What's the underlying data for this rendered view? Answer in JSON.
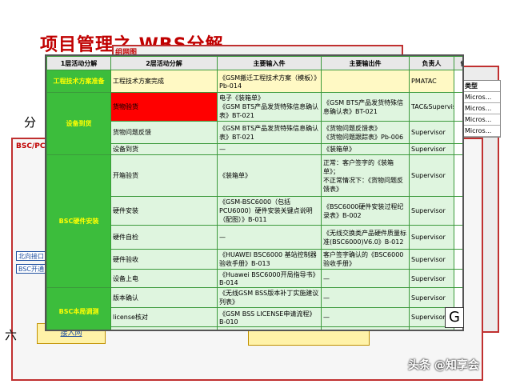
{
  "slide": {
    "title": "项目管理之 WBS分解",
    "left_char_1": "分",
    "left_char_2": "六",
    "side_label_bsc": "BSC/PCU",
    "side_items": [
      "北向接口",
      "BSC开通"
    ],
    "bottom_yellow_1": "接入网",
    "back_red_title": "组网图"
  },
  "back_window_columns": [
    "类型"
  ],
  "back_window_rows": [
    "Micros...",
    "Micros...",
    "Micros...",
    "Micros..."
  ],
  "table": {
    "headers": [
      "1层活动分解",
      "2层活动分解",
      "主要输入件",
      "主要输出件",
      "负责人",
      "备"
    ],
    "rows": [
      {
        "phase": "工程技术方案准备",
        "phase_span": 1,
        "task": "工程技术方案完成",
        "input": "《GSM搬迁工程技术方案（模板）》Pb-014",
        "output": "",
        "owner": "PMATAC",
        "style": "yel"
      },
      {
        "phase": "设备到货",
        "phase_span": 3,
        "task": "货物验货",
        "input": "电子《装箱单》\n《GSM BTS产品发货特殊信息确认表》BT-021",
        "output": "《GSM BTS产品发货特殊信息确认表》BT-021",
        "owner": "TAC&Supervisor",
        "style": "red"
      },
      {
        "task": "货物问题反馈",
        "input": "《GSM BTS产品发货特殊信息确认表》BT-021",
        "output": "《货物问题反馈表》\n《货物问题跟踪表》Pb-006",
        "owner": "Supervisor",
        "style": "grn"
      },
      {
        "task": "设备到货",
        "input": "—",
        "output": "《装箱单》",
        "owner": "Supervisor",
        "style": "grn"
      },
      {
        "phase": "BSC硬件安装",
        "phase_span": 5,
        "task": "开箱验货",
        "input": "《装箱单》",
        "output": "正常：客户签字的《装箱单》；\n不正常情况下：《货物问题反馈表》",
        "owner": "Supervisor",
        "style": "grn"
      },
      {
        "task": "硬件安装",
        "input": "《GSM-BSC6000（包括PCU6000）硬件安装关键点说明（配图）》B-011",
        "output": "《BSC6000硬件安装过程纪录表》B-002",
        "owner": "Supervisor",
        "style": "grn"
      },
      {
        "task": "硬件自检",
        "input": "—",
        "output": "《无线交换类产品硬件质量标准(BSC6000)V6.0》B-012",
        "owner": "Supervisor",
        "style": "grn"
      },
      {
        "task": "硬件验收",
        "input": "《HUAWEI BSC6000 基站控制器验收手册》B-013",
        "output": "客户签字确认的《BSC6000验收手册》",
        "owner": "Supervisor",
        "style": "grn"
      },
      {
        "task": "设备上电",
        "input": "《Huawei BSC6000开局指导书》B-014",
        "output": "—",
        "owner": "Supervisor",
        "style": "grn"
      },
      {
        "phase": "BSC本局调测",
        "phase_span": 3,
        "task": "版本确认",
        "input": "《无线GSM BSS版本补丁实施建议列表》",
        "output": "—",
        "owner": "Supervisor",
        "style": "grn"
      },
      {
        "task": "license核对",
        "input": "《GSM BSS LICENSE申请流程》B-010",
        "output": "—",
        "owner": "Supervisor",
        "style": "grn"
      },
      {
        "task": "",
        "input": "",
        "output": "",
        "owner": "",
        "style": "grn"
      }
    ]
  },
  "g_mark": "G",
  "watermark": "头条 @知享会"
}
